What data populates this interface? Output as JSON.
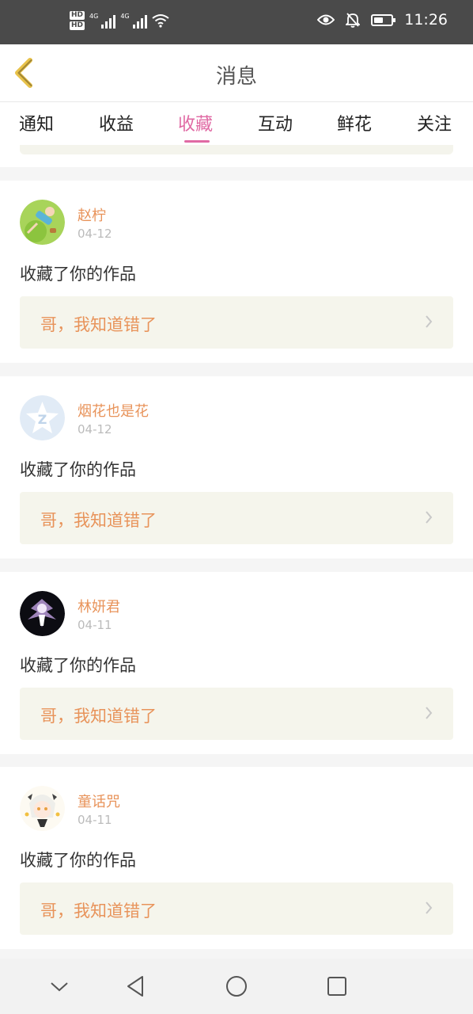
{
  "status_bar": {
    "hd1": "HD",
    "hd2": "HD",
    "net1": "4G",
    "net2": "4G",
    "time": "11:26",
    "battery_level": 0.55,
    "icons": [
      "signal-icon",
      "wifi-icon",
      "eye-icon",
      "bell-off-icon",
      "battery-icon"
    ]
  },
  "header": {
    "back_icon": "chevron-left-icon",
    "title": "消息"
  },
  "tabs": [
    {
      "label": "通知",
      "active": false
    },
    {
      "label": "收益",
      "active": false
    },
    {
      "label": "收藏",
      "active": true
    },
    {
      "label": "互动",
      "active": false
    },
    {
      "label": "鲜花",
      "active": false
    },
    {
      "label": "关注",
      "active": false
    }
  ],
  "accent_color": "#e06aa4",
  "name_color": "#e8935a",
  "messages": [
    {
      "user": "赵柠",
      "date": "04-12",
      "action": "收藏了你的作品",
      "work_title": "哥，我知道错了",
      "avatar": "cartoon-boy-grass"
    },
    {
      "user": "烟花也是花",
      "date": "04-12",
      "action": "收藏了你的作品",
      "work_title": "哥，我知道错了",
      "avatar": "default-star"
    },
    {
      "user": "林妍君",
      "date": "04-11",
      "action": "收藏了你的作品",
      "work_title": "哥，我知道错了",
      "avatar": "dark-purple-character"
    },
    {
      "user": "童话咒",
      "date": "04-11",
      "action": "收藏了你的作品",
      "work_title": "哥，我知道错了",
      "avatar": "anime-girl"
    }
  ],
  "nav_bar": {
    "icons": [
      "collapse-icon",
      "back-triangle-icon",
      "home-circle-icon",
      "recents-square-icon"
    ]
  }
}
